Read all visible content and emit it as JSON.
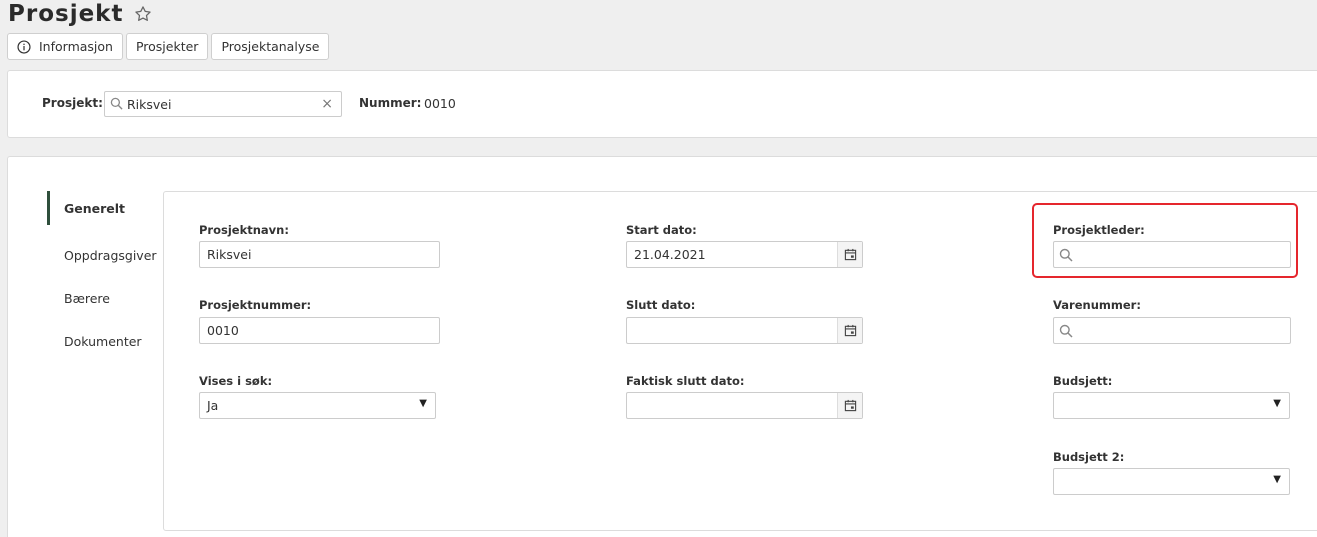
{
  "page": {
    "title": "Prosjekt",
    "tabs": [
      {
        "label": "Informasjon",
        "icon": "info-icon"
      },
      {
        "label": "Prosjekter"
      },
      {
        "label": "Prosjektanalyse"
      }
    ]
  },
  "project_bar": {
    "project_label": "Prosjekt:",
    "project_value": "Riksvei",
    "clear_symbol": "×",
    "number_label": "Nummer:",
    "number_value": "0010"
  },
  "side_nav": {
    "items": [
      {
        "label": "Generelt",
        "active": true
      },
      {
        "label": "Oppdragsgiver"
      },
      {
        "label": "Bærere"
      },
      {
        "label": "Dokumenter"
      }
    ]
  },
  "form": {
    "prosjektnavn": {
      "label": "Prosjektnavn:",
      "value": "Riksvei"
    },
    "prosjektnummer": {
      "label": "Prosjektnummer:",
      "value": "0010"
    },
    "vises_i_sok": {
      "label": "Vises i søk:",
      "value": "Ja"
    },
    "start_dato": {
      "label": "Start dato:",
      "value": "21.04.2021"
    },
    "slutt_dato": {
      "label": "Slutt dato:",
      "value": ""
    },
    "faktisk_slutt_dato": {
      "label": "Faktisk slutt dato:",
      "value": ""
    },
    "prosjektleder": {
      "label": "Prosjektleder:",
      "value": ""
    },
    "varenummer": {
      "label": "Varenummer:",
      "value": ""
    },
    "budsjett": {
      "label": "Budsjett:",
      "value": ""
    },
    "budsjett2": {
      "label": "Budsjett 2:",
      "value": ""
    }
  },
  "colors": {
    "highlight": "#e5262d",
    "active_nav_bar": "#2f4f3c",
    "background": "#efefef"
  }
}
